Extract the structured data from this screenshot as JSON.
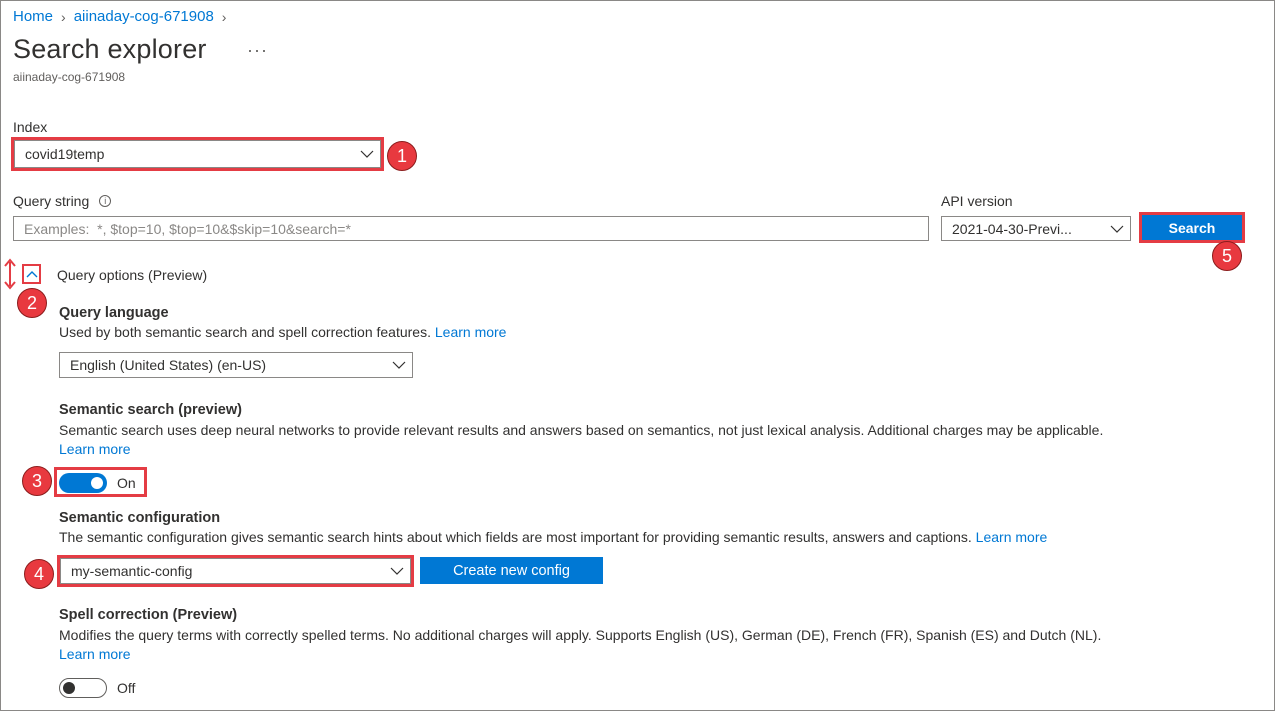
{
  "breadcrumb": {
    "home": "Home",
    "service": "aiinaday-cog-671908"
  },
  "page": {
    "title": "Search explorer",
    "more": "···",
    "subtitle": "aiinaday-cog-671908"
  },
  "index": {
    "label": "Index",
    "value": "covid19temp"
  },
  "query": {
    "label": "Query string",
    "info_icon": "info-icon",
    "placeholder": "Examples:  *, $top=10, $top=10&$skip=10&search=*"
  },
  "api": {
    "label": "API version",
    "value": "2021-04-30-Previ..."
  },
  "search_button": "Search",
  "query_options": {
    "label": "Query options (Preview)",
    "expanded": true
  },
  "query_language": {
    "title": "Query language",
    "description": "Used by both semantic search and spell correction features.",
    "learn_more": "Learn more",
    "value": "English (United States) (en-US)"
  },
  "semantic_search": {
    "title": "Semantic search (preview)",
    "description": "Semantic search uses deep neural networks to provide relevant results and answers based on semantics, not just lexical analysis. Additional charges may be applicable.",
    "learn_more": "Learn more",
    "toggle_label": "On",
    "enabled": true
  },
  "semantic_config": {
    "title": "Semantic configuration",
    "description": "The semantic configuration gives semantic search hints about which fields are most important for providing semantic results, answers and captions.",
    "learn_more": "Learn more",
    "value": "my-semantic-config",
    "create_button": "Create new config"
  },
  "spell_correction": {
    "title": "Spell correction (Preview)",
    "description": "Modifies the query terms with correctly spelled terms. No additional charges will apply. Supports English (US), German (DE), French (FR), Spanish (ES) and Dutch (NL).",
    "learn_more": "Learn more",
    "toggle_label": "Off",
    "enabled": false
  },
  "callouts": [
    "1",
    "2",
    "3",
    "4",
    "5"
  ],
  "colors": {
    "accent": "#0078d4",
    "callout": "#e8393f",
    "highlight_box": "#e43c44"
  }
}
